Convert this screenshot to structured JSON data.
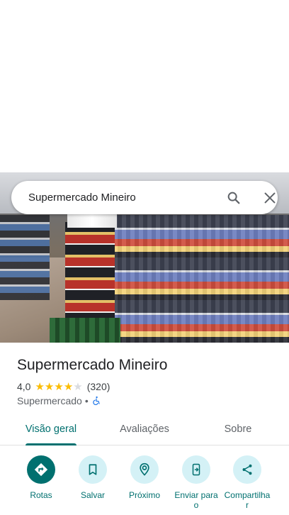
{
  "search": {
    "query": "Supermercado Mineiro",
    "search_icon": "search-icon",
    "close_icon": "close-icon"
  },
  "place": {
    "name": "Supermercado Mineiro",
    "rating": "4,0",
    "stars_filled": 4,
    "stars_total": 5,
    "review_count": "(320)",
    "category": "Supermercado",
    "separator": "•",
    "accessibility_icon": "wheelchair-icon"
  },
  "tabs": [
    {
      "label": "Visão geral",
      "active": true
    },
    {
      "label": "Avaliações",
      "active": false
    },
    {
      "label": "Sobre",
      "active": false
    }
  ],
  "actions": [
    {
      "label": "Rotas",
      "icon": "directions-icon"
    },
    {
      "label": "Salvar",
      "icon": "bookmark-icon"
    },
    {
      "label": "Próximo",
      "icon": "nearby-icon"
    },
    {
      "label": "Enviar para o\nsmartphone",
      "icon": "send-to-phone-icon"
    },
    {
      "label": "Compartilhar",
      "icon": "share-icon"
    }
  ],
  "colors": {
    "accent": "#00706f",
    "accent_light": "#d4f1f6",
    "star": "#fbbc04"
  }
}
